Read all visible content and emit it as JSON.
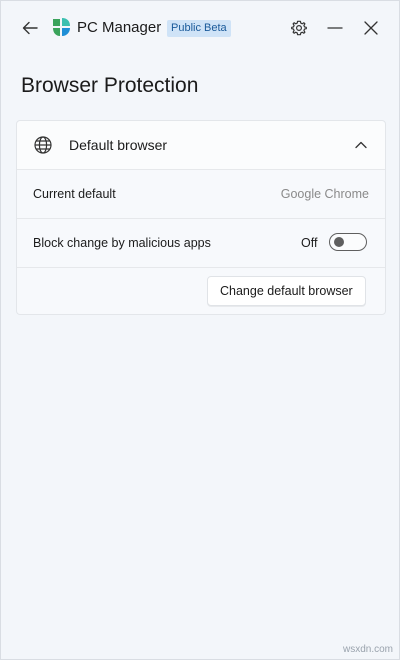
{
  "titlebar": {
    "app_name": "PC Manager",
    "badge": "Public Beta",
    "icons": {
      "back": "arrow-left-icon",
      "logo": "pc-manager-logo-icon",
      "settings": "gear-icon",
      "minimize": "minimize-icon",
      "close": "close-icon"
    }
  },
  "page": {
    "title": "Browser Protection"
  },
  "card": {
    "header_label": "Default browser",
    "header_icon": "globe-icon",
    "expanded_icon": "chevron-up-icon",
    "rows": {
      "current_default": {
        "label": "Current default",
        "value": "Google Chrome"
      },
      "block_change": {
        "label": "Block change by malicious apps",
        "state_label": "Off",
        "enabled": false
      }
    },
    "action_button": "Change default browser"
  },
  "watermark": "wsxdn.com",
  "colors": {
    "background": "#f3f6fa",
    "card": "#f7f9fc",
    "badge_bg": "#cfe3f7",
    "badge_text": "#1a5a9a",
    "logo_green": "#3aa35b",
    "logo_blue": "#1f8fd6",
    "logo_teal": "#3bbfb0"
  }
}
